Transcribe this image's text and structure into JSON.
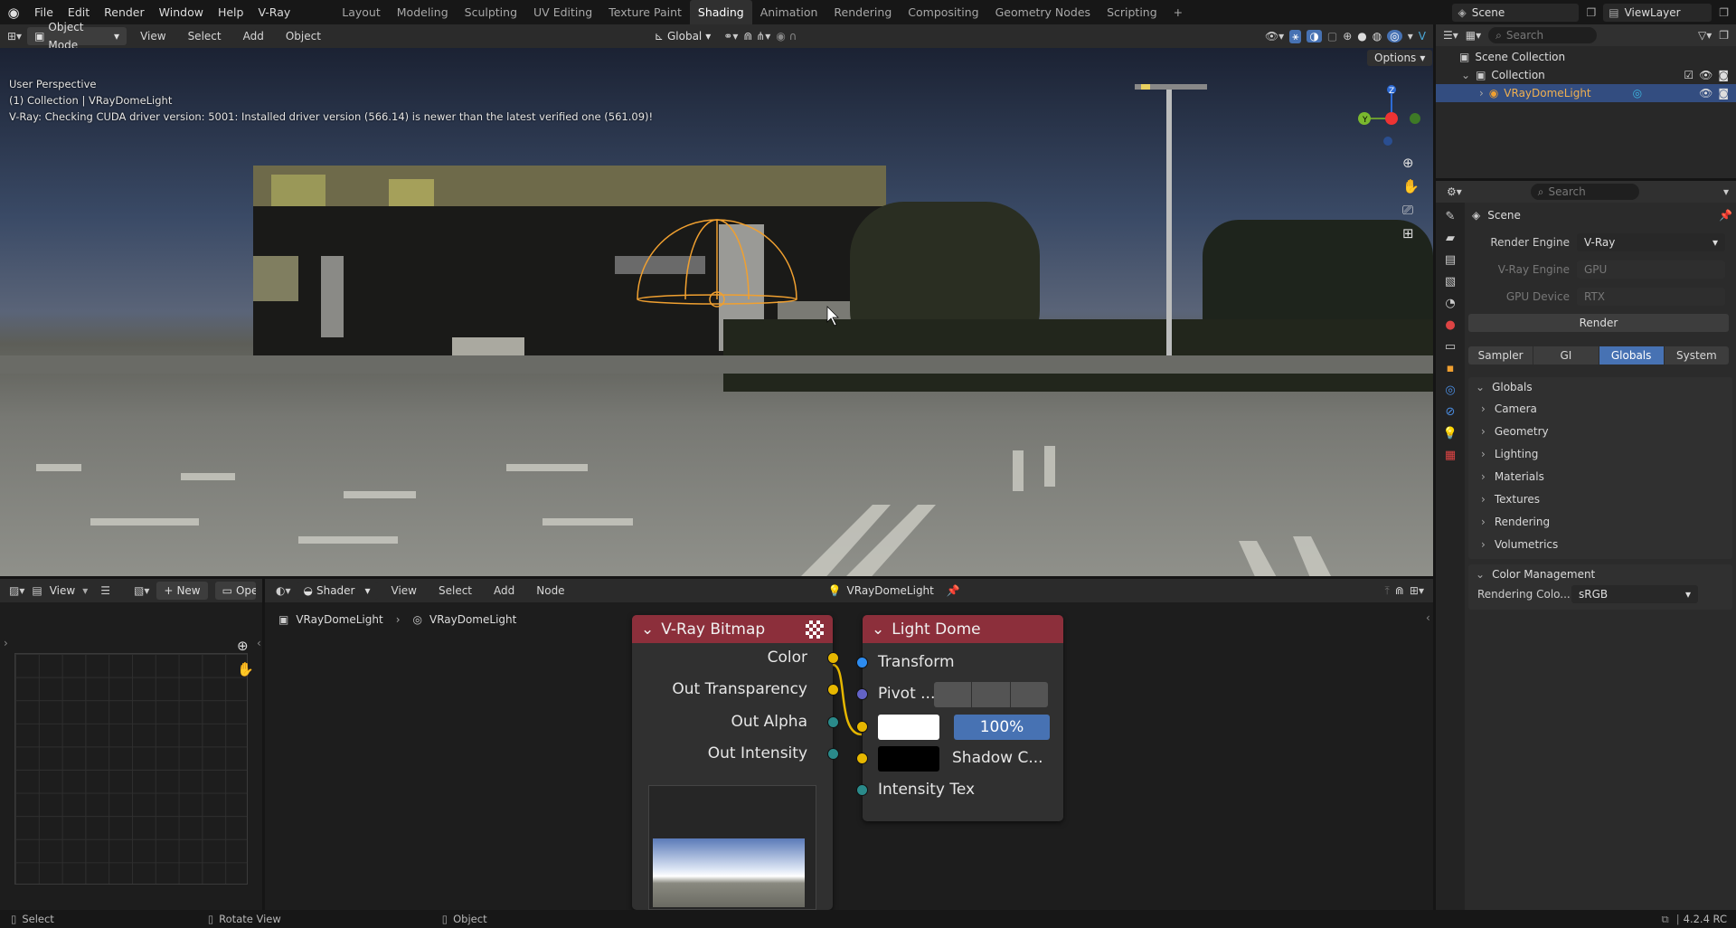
{
  "topbar": {
    "menus": [
      "File",
      "Edit",
      "Render",
      "Window",
      "Help",
      "V-Ray"
    ],
    "workspaces": [
      "Layout",
      "Modeling",
      "Sculpting",
      "UV Editing",
      "Texture Paint",
      "Shading",
      "Animation",
      "Rendering",
      "Compositing",
      "Geometry Nodes",
      "Scripting"
    ],
    "active_workspace": "Shading",
    "scene": "Scene",
    "view_layer": "ViewLayer"
  },
  "viewport": {
    "mode": "Object Mode",
    "menus": [
      "View",
      "Select",
      "Add",
      "Object"
    ],
    "orientation": "Global",
    "options": "Options",
    "perspective": "User Perspective",
    "collection_info": "(1) Collection | VRayDomeLight",
    "message": "V-Ray: Checking CUDA driver version: 5001: Installed driver version (566.14) is newer than the latest verified one (561.09)!",
    "gizmo": {
      "x": "X",
      "y": "Y",
      "z": "Z"
    }
  },
  "outliner": {
    "search_placeholder": "Search",
    "scene_collection": "Scene Collection",
    "collection": "Collection",
    "object": "VRayDomeLight"
  },
  "properties": {
    "search_placeholder": "Search",
    "context": "Scene",
    "render_engine_label": "Render Engine",
    "render_engine": "V-Ray",
    "vray_engine_label": "V-Ray Engine",
    "vray_engine": "GPU",
    "gpu_device_label": "GPU Device",
    "gpu_device": "RTX",
    "render_button": "Render",
    "tabs": [
      "Sampler",
      "GI",
      "Globals",
      "System"
    ],
    "active_tab": "Globals",
    "globals_header": "Globals",
    "globals_items": [
      "Camera",
      "Geometry",
      "Lighting",
      "Materials",
      "Textures",
      "Rendering",
      "Volumetrics"
    ],
    "color_mgmt_header": "Color Management",
    "rendering_colorspace_label": "Rendering Colo...",
    "rendering_colorspace": "sRGB"
  },
  "image_editor": {
    "view": "View",
    "new": "New",
    "open": "Ope"
  },
  "node_editor": {
    "type": "Shader",
    "menus": [
      "View",
      "Select",
      "Add",
      "Node"
    ],
    "object": "VRayDomeLight",
    "breadcrumb": [
      "VRayDomeLight",
      "VRayDomeLight"
    ]
  },
  "nodes": {
    "bitmap": {
      "title": "V-Ray Bitmap",
      "outputs": [
        "Color",
        "Out Transparency",
        "Out Alpha",
        "Out Intensity"
      ]
    },
    "dome": {
      "title": "Light Dome",
      "inputs": [
        "Transform",
        "Pivot ...",
        "Shadow C...",
        "Intensity Tex"
      ],
      "intensity": "100%"
    }
  },
  "statusbar": {
    "select": "Select",
    "rotate": "Rotate View",
    "object": "Object",
    "version": "4.2.4 RC"
  },
  "colors": {
    "accent": "#4772b3",
    "node_header": "#8c2f3b",
    "socket_yellow": "#e6b700",
    "socket_blue": "#2d8cf0",
    "socket_purple": "#6363c7",
    "socket_teal": "#2a8a8a",
    "selection": "#f0a030"
  }
}
